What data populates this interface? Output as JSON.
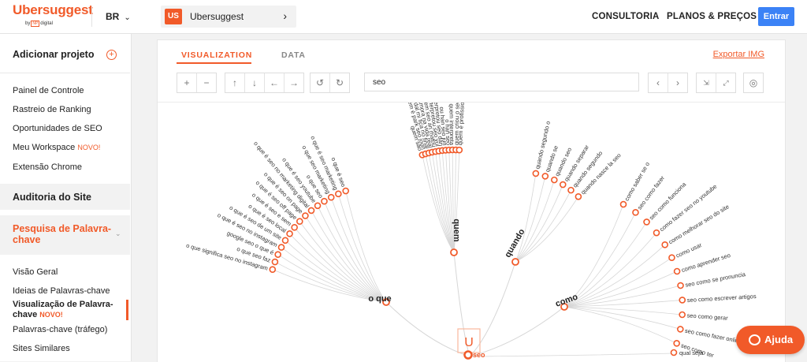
{
  "header": {
    "brand": "Ubersuggest",
    "by": "by",
    "np": "NP",
    "digital": "digital",
    "lang": "BR",
    "project_badge": "US",
    "project_name": "Ubersuggest",
    "nav_consultoria": "CONSULTORIA",
    "nav_planos": "PLANOS & PREÇOS",
    "entrar": "Entrar"
  },
  "sidebar": {
    "add_project": "Adicionar projeto",
    "items1": [
      "Painel de Controle",
      "Rastreio de Ranking",
      "Oportunidades de SEO",
      "Meu Workspace",
      "Extensão Chrome"
    ],
    "novo": "NOVO!",
    "novo2": "NOVO!",
    "auditoria": "Auditoria do Site",
    "pesquisa": "Pesquisa de Palavra-",
    "pesquisa2": "chave",
    "items2": [
      "Visão Geral",
      "Ideias de Palavras-chave",
      "Visualização de Palavra-",
      "chave",
      "Palavras-chave (tráfego)",
      "Sites Similares"
    ]
  },
  "panel": {
    "tab_visualization": "VISUALIZATION",
    "tab_data": "DATA",
    "export": "Exportar IMG",
    "search_value": "seo"
  },
  "viz": {
    "center": "seo",
    "center_letter": "U",
    "branches": [
      "o que",
      "quem",
      "quando",
      "como"
    ],
    "o_que_leaves": [
      "o que significa seo no instagram",
      "o que seo faz",
      "google seo o que é",
      "o que é seo no instagram",
      "o que é seo de um site",
      "o que é seo local",
      "o que é seo e sem",
      "o que é seo off page",
      "o que é seo on page",
      "o que é seo no marketing digital",
      "o que é seo youtube",
      "o que seo",
      "o que seo marketing",
      "o que é seo marketing",
      "o que é seo"
    ],
    "quem_leaves": [
      "quem são",
      "quem é park seo joon",
      "seo dal mi fica no final",
      "namora na vida real",
      "em seo ari matou",
      "interpretou seo yul",
      "interpretou seo dan",
      "ou han seo jun",
      "o han seo",
      "quem interpreta",
      "quem criou o seo",
      "quem é profissional"
    ],
    "quando_leaves": [
      "quando segundo o",
      "quando se",
      "quando seo",
      "quando separar",
      "quando segundo",
      "quando nasce la seo"
    ],
    "como_leaves": [
      "como saber se o",
      "seo como fazer",
      "seo como funciona",
      "como fazer seo no youtube",
      "como melhorar seo do site",
      "como usar",
      "como aprender seo",
      "seo como se pronuncia",
      "seo como escrever artigos",
      "seo como gerar",
      "seo como fazer online",
      "seo como ter"
    ],
    "extra_leaf": "qual seja",
    "colors": {
      "accent": "#f15a29",
      "line": "#d6d6d6"
    }
  },
  "help": {
    "label": "Ajuda"
  }
}
